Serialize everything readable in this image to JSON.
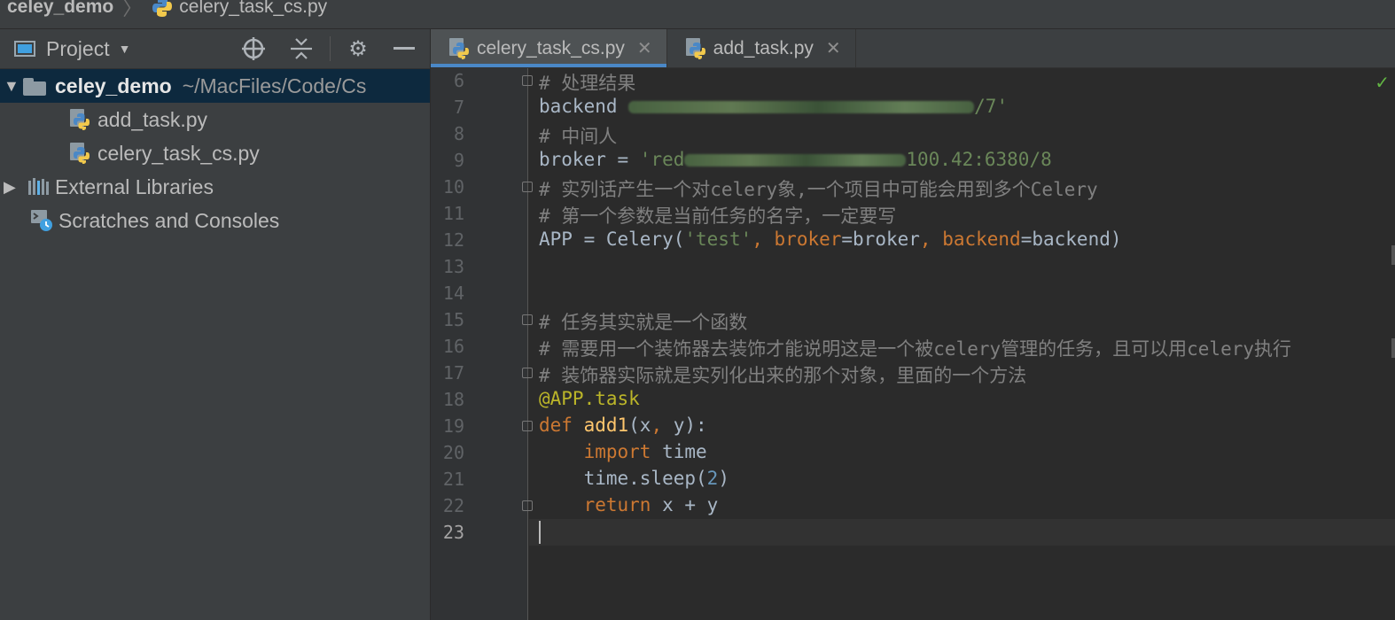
{
  "breadcrumb": {
    "project": "celey_demo",
    "file": "celery_task_cs.py"
  },
  "sidebar": {
    "title": "Project",
    "root": {
      "name": "celey_demo",
      "path": "~/MacFiles/Code/Cs"
    },
    "files": [
      "add_task.py",
      "celery_task_cs.py"
    ],
    "external_libraries": "External Libraries",
    "scratches": "Scratches and Consoles"
  },
  "tabs": [
    {
      "label": "celery_task_cs.py",
      "active": true
    },
    {
      "label": "add_task.py",
      "active": false
    }
  ],
  "editor": {
    "current_line": 23,
    "lines": [
      {
        "num": "6",
        "parts": [
          [
            "c-comment",
            "# 处理结果"
          ]
        ]
      },
      {
        "num": "7",
        "parts": [
          [
            "",
            "backend "
          ],
          [
            "blur",
            ""
          ],
          [
            "c-string",
            "/7'"
          ]
        ]
      },
      {
        "num": "8",
        "parts": [
          [
            "c-comment",
            "# 中间人"
          ]
        ]
      },
      {
        "num": "9",
        "parts": [
          [
            "",
            "broker = "
          ],
          [
            "c-string",
            "'red"
          ],
          [
            "blur",
            ""
          ],
          [
            "c-string",
            "100.42:6380/8"
          ]
        ]
      },
      {
        "num": "10",
        "parts": [
          [
            "c-comment",
            "# 实列话产生一个对celery象,一个项目中可能会用到多个Celery"
          ]
        ]
      },
      {
        "num": "11",
        "parts": [
          [
            "c-comment",
            "# 第一个参数是当前任务的名字，一定要写"
          ]
        ]
      },
      {
        "num": "12",
        "parts": [
          [
            "",
            "APP = Celery("
          ],
          [
            "c-string",
            "'test'"
          ],
          [
            "c-kw",
            ", "
          ],
          [
            "c-param",
            "broker"
          ],
          [
            "",
            "=broker"
          ],
          [
            "c-kw",
            ", "
          ],
          [
            "c-param",
            "backend"
          ],
          [
            "",
            "=backend)"
          ]
        ]
      },
      {
        "num": "13",
        "parts": []
      },
      {
        "num": "14",
        "parts": []
      },
      {
        "num": "15",
        "parts": [
          [
            "c-comment",
            "# 任务其实就是一个函数"
          ]
        ]
      },
      {
        "num": "16",
        "parts": [
          [
            "c-comment",
            "# 需要用一个装饰器去装饰才能说明这是一个被celery管理的任务，且可以用celery执行"
          ]
        ]
      },
      {
        "num": "17",
        "parts": [
          [
            "c-comment",
            "# 装饰器实际就是实列化出来的那个对象，里面的一个方法"
          ]
        ]
      },
      {
        "num": "18",
        "parts": [
          [
            "c-deco",
            "@APP.task"
          ]
        ]
      },
      {
        "num": "19",
        "parts": [
          [
            "c-kw",
            "def "
          ],
          [
            "c-func",
            "add1"
          ],
          [
            "",
            "(x"
          ],
          [
            "c-kw",
            ", "
          ],
          [
            "",
            "y):"
          ]
        ]
      },
      {
        "num": "20",
        "parts": [
          [
            "",
            "    "
          ],
          [
            "c-kw",
            "import "
          ],
          [
            "",
            "time"
          ]
        ]
      },
      {
        "num": "21",
        "parts": [
          [
            "",
            "    time.sleep("
          ],
          [
            "c-num",
            "2"
          ],
          [
            "",
            ")"
          ]
        ]
      },
      {
        "num": "22",
        "parts": [
          [
            "",
            "    "
          ],
          [
            "c-kw",
            "return "
          ],
          [
            "",
            "x + y"
          ]
        ]
      },
      {
        "num": "23",
        "parts": []
      }
    ]
  }
}
